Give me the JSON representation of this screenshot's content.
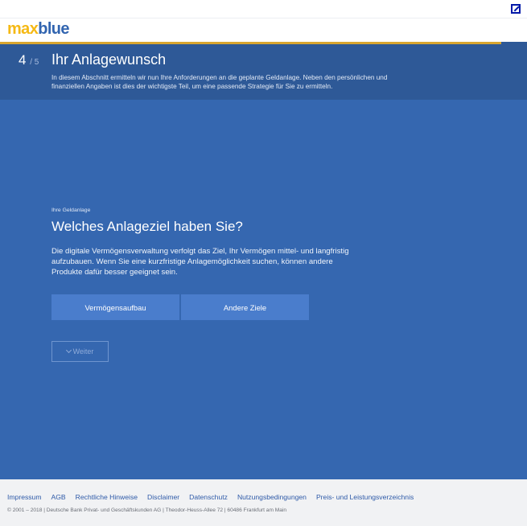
{
  "brand": {
    "part1": "max",
    "part2": "blue"
  },
  "header": {
    "step_current": "4",
    "step_total": "/ 5",
    "title": "Ihr Anlagewunsch",
    "description": "In diesem Abschnitt ermitteln wir nun Ihre Anforderungen an die geplante Geldanlage. Neben den persönlichen und finanziellen Angaben ist dies der wichtigste Teil, um eine passende Strategie für Sie zu ermitteln."
  },
  "main": {
    "eyebrow": "Ihre Geldanlage",
    "question": "Welches Anlageziel haben Sie?",
    "explanation": "Die digitale Vermögensverwaltung verfolgt das Ziel, Ihr Vermögen mittel- und langfristig aufzubauen. Wenn Sie eine kurzfristige Anlagemöglichkeit suchen, können andere Produkte dafür besser geeignet sein.",
    "choices": [
      "Vermögensaufbau",
      "Andere Ziele"
    ],
    "next_label": "Weiter"
  },
  "footer": {
    "links": [
      "Impressum",
      "AGB",
      "Rechtliche Hinweise",
      "Disclaimer",
      "Datenschutz",
      "Nutzungsbedingungen",
      "Preis- und Leistungsverzeichnis"
    ],
    "copyright": "© 2001 – 2018 | Deutsche Bank Privat- und Geschäftskunden AG | Theodor-Heuss-Allee 72 | 60486 Frankfurt am Main"
  },
  "colors": {
    "brand_yellow": "#f5b915",
    "brand_blue": "#3265b0",
    "header_band": "#2e5997",
    "main_bg": "#3567b0",
    "button": "#4a7dcc",
    "gold_line": "#d9a62f"
  }
}
